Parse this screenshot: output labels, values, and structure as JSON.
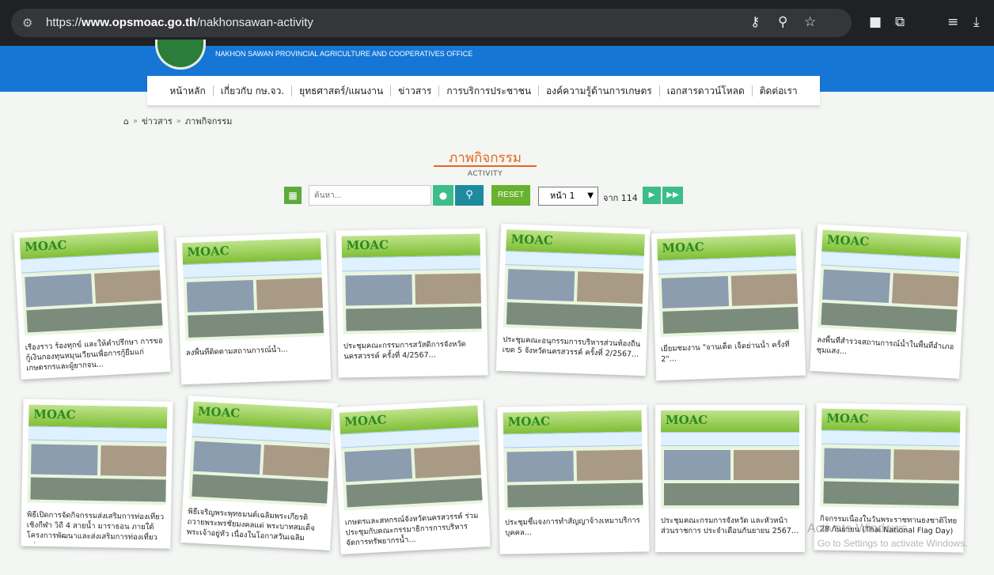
{
  "browser": {
    "tune_icon": "tune-icon",
    "url_protocol": "https://",
    "url_domain": "www.opsmoac.go.th",
    "url_path": "/nakhonsawan-activity",
    "icons": [
      "key-icon",
      "zoom-icon",
      "star-icon",
      "extension-icon",
      "puzzle-icon",
      "reading-list-icon",
      "download-icon"
    ]
  },
  "header": {
    "office_name": "NAKHON SAWAN PROVINCIAL AGRICULTURE AND COOPERATIVES OFFICE",
    "brand_color": "#1676d6"
  },
  "nav": {
    "items": [
      "หน้าหลัก",
      "เกี่ยวกับ กษ.จว.",
      "ยุทธศาสตร์/แผนงาน",
      "ข่าวสาร",
      "การบริการประชาชน",
      "องค์ความรู้ด้านการเกษตร",
      "เอกสารดาวน์โหลด",
      "ติดต่อเรา"
    ]
  },
  "breadcrumb": {
    "home_icon": "home-icon",
    "sep": "»",
    "items": [
      "ข่าวสาร",
      "ภาพกิจกรรม"
    ]
  },
  "section": {
    "title": "ภาพกิจกรรม",
    "subtitle": "ACTIVITY",
    "accent": "#e8661d"
  },
  "search": {
    "placeholder": "ค้นหา...",
    "reset_label": "RESET",
    "page_selected": "หน้า 1",
    "page_total": "จาก 114",
    "next_label": "▶",
    "last_label": "▶▶"
  },
  "cards": [
    {
      "caption": "เรืองราว ร้องทุกข์ และให้คำปรึกษา การขอกู้เงินกองทุนหมุนเวียนเพื่อการกู้ยืมแก่เกษตรกรและผู้ยากจน..."
    },
    {
      "caption": "ลงพื้นที่ติดตามสถานการณ์น้ำ..."
    },
    {
      "caption": "ประชุมคณะกรรมการสวัสดิการจังหวัดนครสวรรค์ ครั้งที่ 4/2567..."
    },
    {
      "caption": "ประชุมคณะอนุกรรมการบริหารส่วนท้องถิ่นเขต 5 จังหวัดนครสวรรค์ ครั้งที่ 2/2567..."
    },
    {
      "caption": "เยี่ยมชมงาน \"จานเด็ด เจ็ดย่านน้ำ ครั้งที่ 2\"..."
    },
    {
      "caption": "ลงพื้นที่สำรวจสถานการณ์น้ำในพื้นที่อำเภอชุมแสง..."
    },
    {
      "caption": "พิธีเปิดการจัดกิจกรรมส่งเสริมการท่องเที่ยวเชิงกีฬา วิถี 4 สายน้ำ มาราธอน ภายใต้โครงการพัฒนาและส่งเสริมการท่องเที่ยวกลุ่ม..."
    },
    {
      "caption": "พิธีเจริญพระพุทธมนต์เฉลิมพระเกียรติ ถวายพระพรชัยมงคลแด่ พระบาทสมเด็จพระเจ้าอยู่หัว เนื่องในโอกาสวันเฉลิมพระชนมพรรษา..."
    },
    {
      "caption": "เกษตรและสหกรณ์จังหวัดนครสวรรค์ ร่วมประชุมกับคณะกรรมาธิการการบริหารจัดการทรัพยากรน้ำ..."
    },
    {
      "caption": "ประชุมชี้แจงการทำสัญญาจ้างเหมาบริการบุคคล..."
    },
    {
      "caption": "ประชุมคณะกรมการจังหวัด และหัวหน้าส่วนราชการ ประจำเดือนกันยายน 2567..."
    },
    {
      "caption": "กิจกรรมเนื่องในวันพระราชทานธงชาติไทย 28 กันยายน (Thai National Flag Day)"
    }
  ],
  "watermark": {
    "title": "Activate Windows",
    "subtitle": "Go to Settings to activate Windows."
  }
}
